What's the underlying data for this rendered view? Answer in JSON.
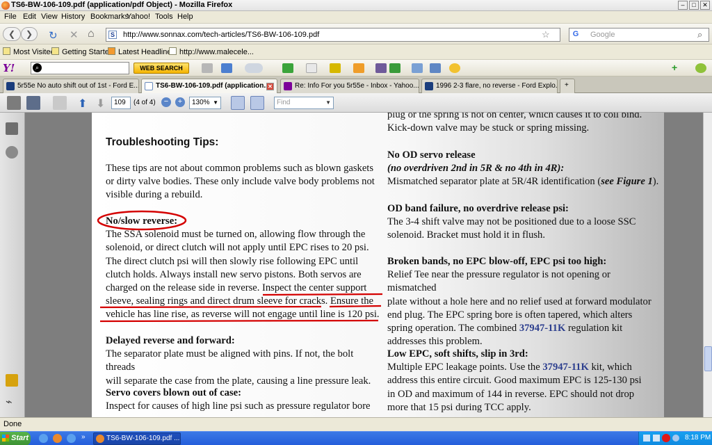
{
  "window": {
    "title": "TS6-BW-106-109.pdf (application/pdf Object) - Mozilla Firefox"
  },
  "menu": [
    "File",
    "Edit",
    "View",
    "History",
    "Bookmarks",
    "Yahoo!",
    "Tools",
    "Help"
  ],
  "nav": {
    "url": "http://www.sonnax.com/tech-articles/TS6-BW-106-109.pdf",
    "search_placeholder": "Google"
  },
  "bookmarks": [
    "Most Visited",
    "Getting Started",
    "Latest Headlines",
    "http://www.malecele..."
  ],
  "yahoo_toolbar": {
    "button": "WEB SEARCH"
  },
  "tabs": [
    {
      "label": "5r55e No auto shift out of 1st - Ford E...",
      "active": false
    },
    {
      "label": "TS6-BW-106-109.pdf (application...",
      "active": true
    },
    {
      "label": "Re: Info For you 5r55e - Inbox - Yahoo...",
      "active": false
    },
    {
      "label": "1996 2-3 flare, no reverse - Ford Explo...",
      "active": false
    }
  ],
  "pdf_toolbar": {
    "page_number": "109",
    "page_info": "(4 of 4)",
    "zoom": "130%",
    "find_placeholder": "Find"
  },
  "document": {
    "col1": [
      {
        "id": "tips_title",
        "text": "Troubleshooting Tips:",
        "style": "h2"
      },
      {
        "id": "intro",
        "lines": [
          "These tips are not about common problems such as blown gaskets",
          "or dirty valve bodies. These only include valve body problems not",
          "visible during a rebuild."
        ]
      },
      {
        "id": "no_slow",
        "heading": "No/slow reverse:",
        "lines": [
          "The SSA solenoid must be turned on, allowing flow through the",
          "solenoid, or direct clutch will not apply until EPC rises to 20 psi.",
          "The direct clutch psi will then slowly rise following EPC until",
          "clutch holds. Always install new servo pistons. Both servos are",
          "charged on the release side in reverse. Inspect the center support",
          "sleeve, sealing rings  and direct drum sleeve for cracks. Ensure the",
          "vehicle has line rise, as reverse will not engage until line is 120 psi."
        ]
      },
      {
        "id": "delayed",
        "heading": "Delayed reverse and forward:",
        "lines": [
          "The separator plate must be aligned with pins. If not, the bolt threads",
          "will separate the case from the plate, causing a line pressure leak."
        ]
      },
      {
        "id": "servo",
        "heading": "Servo covers blown out of case:",
        "lines": [
          "Inspect for causes of high line psi such as pressure regulator bore"
        ]
      }
    ],
    "col2_top": [
      "plug or the spring is not on center, which causes it to coil bind.",
      "Kick-down valve may be stuck or spring missing."
    ],
    "no_od": {
      "heading": "No OD servo release",
      "subheading": "(no overdriven 2nd in 5R & no 4th in 4R):",
      "line_pre": "Mismatched separator plate at 5R/4R identification (",
      "line_ref": "see Figure 1",
      "line_post": ")."
    },
    "od_band": {
      "heading": "OD band failure, no overdrive release psi:",
      "lines": [
        "The 3-4 shift valve may not be positioned due to a loose SSC",
        "solenoid. Bracket must hold it in flush."
      ]
    },
    "broken": {
      "heading": "Broken bands, no EPC blow-off, EPC psi too high:",
      "lines": [
        "Relief Tee near the pressure regulator is not opening or mismatched",
        "plate without a hole here and no relief used at forward modulator",
        "end plug. The EPC spring bore is often tapered, which alters"
      ],
      "line4_pre": "spring operation. The combined ",
      "line4_link": "37947-11K",
      "line4_post": " regulation kit",
      "line5": "addresses this problem."
    },
    "low_epc": {
      "heading": "Low EPC, soft shifts, slip in 3rd:",
      "line1_pre": "Multiple EPC leakage points. Use the ",
      "line1_link": "37947-11K",
      "line1_post": " kit, which",
      "lines": [
        "address this entire circuit. Good maximum EPC is 125-130 psi",
        "in OD and maximum of 144 in reverse. EPC should not drop",
        "more that 15 psi during TCC apply."
      ]
    }
  },
  "status": {
    "text": "Done"
  },
  "taskbar": {
    "start": "Start",
    "item": "TS6-BW-106-109.pdf ...",
    "clock": "8:18 PM"
  },
  "colors": {
    "annotation": "#d40000",
    "link": "#2c3e8e"
  }
}
